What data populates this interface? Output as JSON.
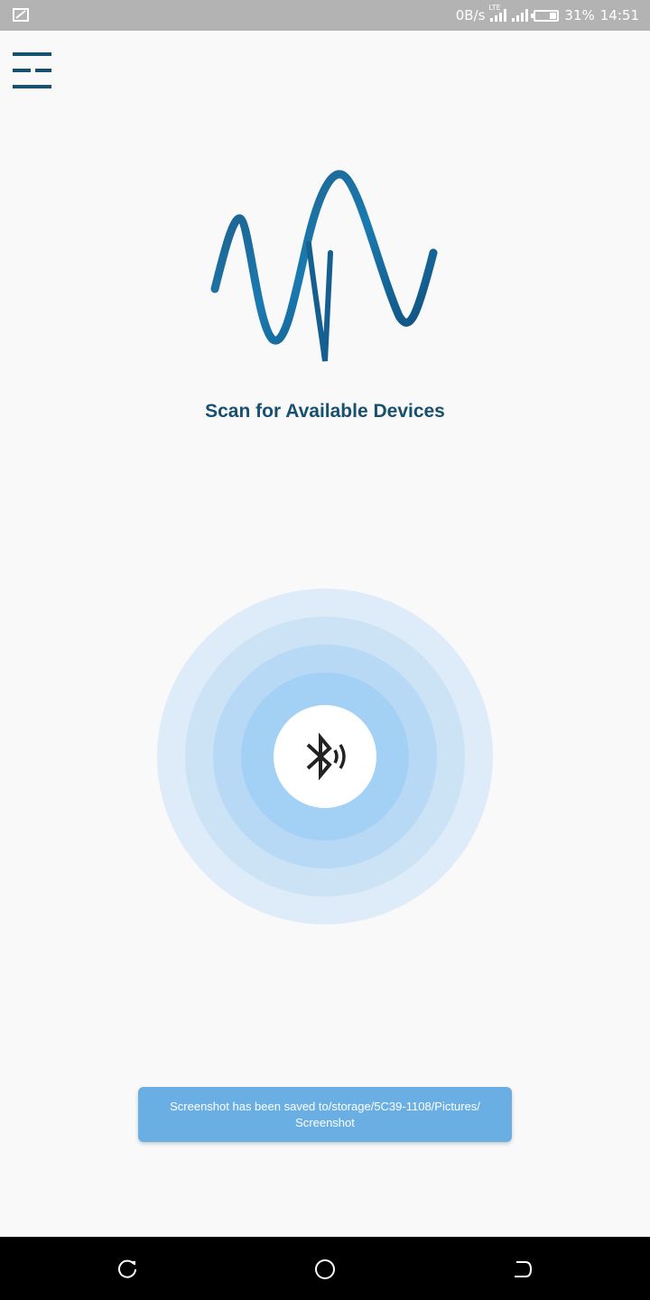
{
  "status_bar": {
    "speed": "0B/s",
    "network": "LTE",
    "battery_text": "31%",
    "battery_level": 0.31,
    "time": "14:51"
  },
  "icons": {
    "menu": "menu-icon",
    "logo": "wave-logo",
    "bluetooth": "bluetooth-searching-icon",
    "recents": "recents-icon",
    "home": "home-icon",
    "back": "back-icon"
  },
  "colors": {
    "accent": "#18506f",
    "toast": "#6aafe4"
  },
  "main": {
    "title": "Scan for Available Devices"
  },
  "toast": {
    "message": "Screenshot has been saved to/storage/5C39-1108/Pictures/ Screenshot"
  }
}
